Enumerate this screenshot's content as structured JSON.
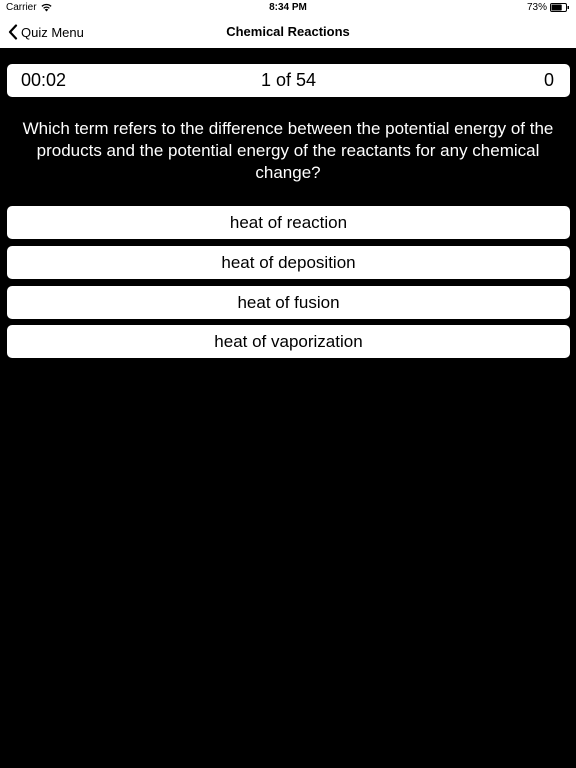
{
  "status_bar": {
    "carrier": "Carrier",
    "time": "8:34 PM",
    "battery": "73%",
    "battery_level": 0.73
  },
  "nav": {
    "back_label": "Quiz Menu",
    "title": "Chemical Reactions"
  },
  "quiz": {
    "timer": "00:02",
    "progress": "1 of 54",
    "score": "0",
    "question": "Which term refers to the difference between the potential energy of the products and the potential energy of the reactants for any chemical change?",
    "answers": [
      "heat of reaction",
      "heat of deposition",
      "heat of fusion",
      "heat of vaporization"
    ]
  },
  "colors": {
    "background": "#000000",
    "panel": "#ffffff",
    "text_dark": "#000000",
    "text_light": "#ffffff"
  }
}
